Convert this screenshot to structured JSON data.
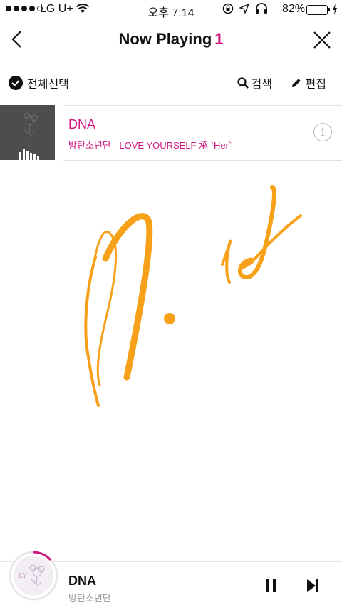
{
  "status_bar": {
    "carrier": "LG U+",
    "time": "오후 7:14",
    "battery": "82%",
    "battery_level": 0.82,
    "battery_color": "#4cd964"
  },
  "header": {
    "back_icon": "chevron-left-icon",
    "title": "Now Playing",
    "count": "1",
    "close_icon": "close-icon"
  },
  "toolbar": {
    "select_all": "전체선택",
    "search": "검색",
    "edit": "편집"
  },
  "songs": [
    {
      "title": "DNA",
      "subtitle": "방탄소년단 - LOVE YOURSELF 承 `Her`",
      "info_icon": "info-icon"
    }
  ],
  "player": {
    "title": "DNA",
    "artist": "방탄소년단",
    "progress": 0.12,
    "pause_icon": "pause-icon",
    "next_icon": "skip-next-icon"
  },
  "colors": {
    "accent": "#d0157e",
    "signature": "#f7a11a"
  }
}
